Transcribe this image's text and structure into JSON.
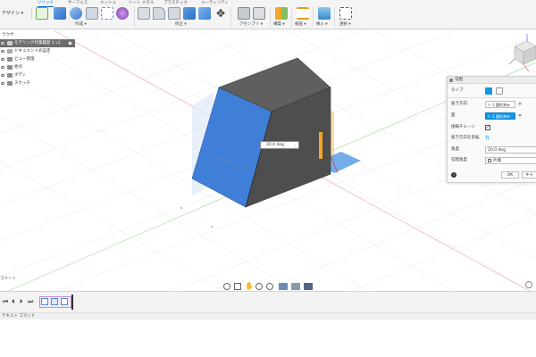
{
  "ribbon": {
    "workspace": "デザイン ▾",
    "tabs": [
      "ソリッド",
      "サーフェス",
      "メッシュ",
      "シート メタル",
      "プラスチック",
      "ユーティリティ"
    ],
    "groups": [
      "作成 ▾",
      "修正 ▾",
      "アセンブリ ▾",
      "構築 ▾",
      "検査 ▾",
      "挿入 ▾",
      "選択 ▾"
    ]
  },
  "browser": {
    "header": "ラウザ",
    "items": [
      "モデリング作業履歴 1 v1",
      "ドキュメントの設定",
      "ビュー管理",
      "原点",
      "ボディ",
      "スケッチ"
    ]
  },
  "viewport": {
    "angle_value": "20.0 deg"
  },
  "dialog": {
    "title": "勾配",
    "type_label": "タイプ",
    "pull_direction_label": "抜き方向",
    "pull_direction_value": "1 選択済み",
    "faces_label": "面",
    "faces_value": "1 選択済み",
    "tangent_chain_label": "接線チェーン",
    "flip_direction_label": "抜き方向を反転",
    "angle_label": "角度",
    "angle_value": "20.0 deg",
    "parting_plane_label": "勾配角度",
    "parting_plane_value": "片側",
    "ok_label": "OK",
    "cancel_label": "キャ"
  },
  "comments": {
    "label": "コメント"
  },
  "status": {
    "text": "テキスト コマンド"
  },
  "colors": {
    "selected_face": "#3f7fd8",
    "body_dark": "#5a5a5a",
    "accent": "#1396e8",
    "orange": "#f5a623"
  }
}
